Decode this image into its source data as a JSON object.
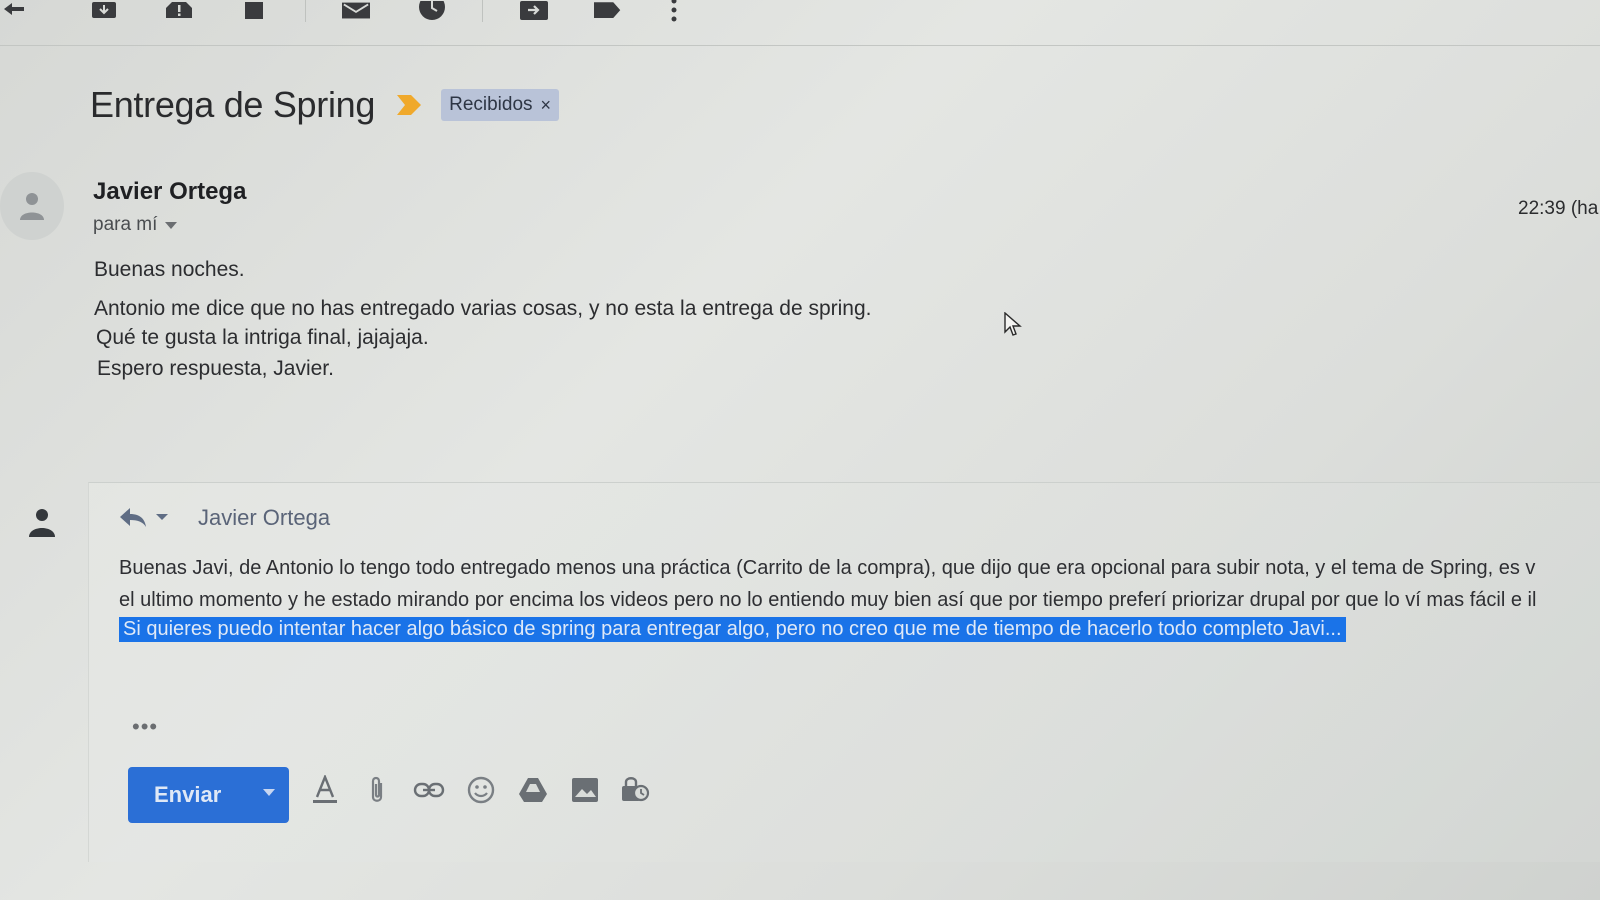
{
  "toolbar": {
    "icons": [
      "archive-icon",
      "report-spam-icon",
      "delete-icon",
      "mark-unread-icon",
      "snooze-icon",
      "move-to-icon",
      "label-icon",
      "more-options-icon"
    ]
  },
  "thread": {
    "subject": "Entrega de Spring",
    "label": "Recibidos",
    "label_remove": "×"
  },
  "message": {
    "sender": "Javier Ortega",
    "recipient": "para mí",
    "time": "22:39 (ha",
    "body": [
      "Buenas noches.",
      "Antonio me dice que no has entregado varias cosas, y no esta la entrega de spring.",
      "Qué te gusta la intriga final, jajajaja.",
      "Espero respuesta, Javier."
    ]
  },
  "reply": {
    "to": "Javier Ortega",
    "lines": [
      "Buenas Javi, de Antonio lo tengo todo entregado menos una práctica (Carrito de la compra), que dijo que era opcional para subir nota, y el tema de Spring, es v",
      "el ultimo momento y he estado mirando por encima los videos pero no lo entiendo muy bien así que por tiempo preferí priorizar drupal por que lo ví mas fácil e il",
      "Si quieres puedo intentar hacer algo básico de spring para entregar algo, pero no creo que me de tiempo de hacerlo todo completo Javi..."
    ],
    "more": "•••",
    "send_label": "Enviar",
    "accent": "#1a73e8"
  }
}
